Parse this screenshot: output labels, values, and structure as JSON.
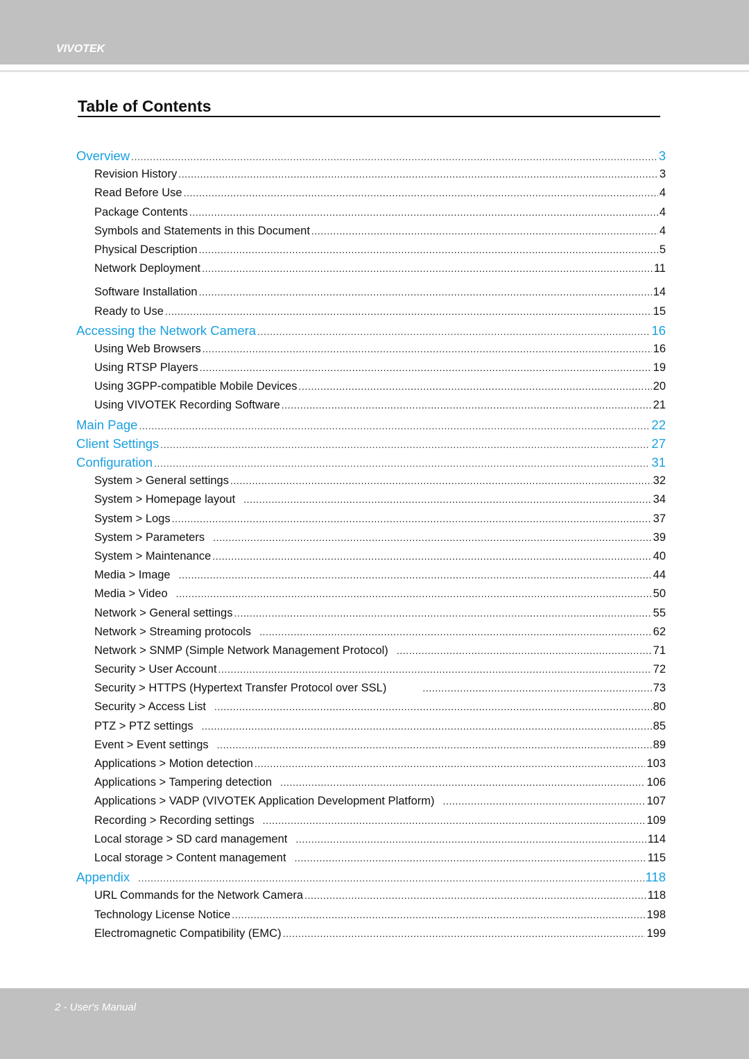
{
  "header": {
    "brand": "VIVOTEK"
  },
  "title": "Table of Contents",
  "colors": {
    "accent": "#1aa0e0",
    "band": "#bfc0bf",
    "text": "#111111"
  },
  "entries": [
    {
      "level": 1,
      "label": "Overview",
      "page": "3"
    },
    {
      "level": 2,
      "label": "Revision History",
      "page": "3"
    },
    {
      "level": 2,
      "label": "Read Before Use",
      "page": "4"
    },
    {
      "level": 2,
      "label": "Package Contents",
      "page": "4"
    },
    {
      "level": 2,
      "label": "Symbols and Statements in this Document",
      "page": "4"
    },
    {
      "level": 2,
      "label": "Physical Description",
      "page": "5"
    },
    {
      "level": 2,
      "label": "Network Deployment",
      "page": "11"
    },
    {
      "level": 2,
      "label": "Software Installation",
      "page": "14",
      "gap": true
    },
    {
      "level": 2,
      "label": "Ready to Use",
      "page": "15"
    },
    {
      "level": 1,
      "label": "Accessing the Network Camera",
      "page": "16"
    },
    {
      "level": 2,
      "label": "Using Web Browsers",
      "page": "16"
    },
    {
      "level": 2,
      "label": "Using RTSP Players",
      "page": "19"
    },
    {
      "level": 2,
      "label": "Using 3GPP-compatible Mobile Devices",
      "page": "20"
    },
    {
      "level": 2,
      "label": "Using VIVOTEK Recording Software",
      "page": "21"
    },
    {
      "level": 1,
      "label": "Main Page",
      "page": "22"
    },
    {
      "level": 1,
      "label": "Client Settings",
      "page": "27"
    },
    {
      "level": 1,
      "label": "Configuration",
      "page": "31"
    },
    {
      "level": 2,
      "label": "System > General settings",
      "page": "32"
    },
    {
      "level": 2,
      "label": "System > Homepage layout",
      "page": "34",
      "pad": true
    },
    {
      "level": 2,
      "label": "System > Logs",
      "page": "37"
    },
    {
      "level": 2,
      "label": "System > Parameters",
      "page": "39",
      "pad": true
    },
    {
      "level": 2,
      "label": "System > Maintenance",
      "page": "40"
    },
    {
      "level": 2,
      "label": "Media > Image",
      "page": "44",
      "pad": true
    },
    {
      "level": 2,
      "label": "Media > Video",
      "page": "50",
      "pad": true
    },
    {
      "level": 2,
      "label": "Network > General settings",
      "page": "55"
    },
    {
      "level": 2,
      "label": "Network > Streaming protocols",
      "page": "62",
      "pad": true
    },
    {
      "level": 2,
      "label": "Network > SNMP (Simple Network Management Protocol)",
      "page": "71",
      "pad": true
    },
    {
      "level": 2,
      "label": "Security > User Account",
      "page": "72"
    },
    {
      "level": 2,
      "label": "Security >  HTTPS (Hypertext Transfer Protocol over SSL)",
      "page": "73",
      "widepad": true
    },
    {
      "level": 2,
      "label": "Security >  Access List",
      "page": "80",
      "pad": true
    },
    {
      "level": 2,
      "label": "PTZ > PTZ settings",
      "page": "85",
      "pad": true
    },
    {
      "level": 2,
      "label": "Event > Event settings",
      "page": "89",
      "pad": true
    },
    {
      "level": 2,
      "label": "Applications > Motion detection",
      "page": "103"
    },
    {
      "level": 2,
      "label": "Applications > Tampering detection",
      "page": "106",
      "pad": true
    },
    {
      "level": 2,
      "label": "Applications > VADP (VIVOTEK Application Development Platform)",
      "page": "107",
      "pad": true
    },
    {
      "level": 2,
      "label": "Recording > Recording settings",
      "page": "109",
      "pad": true
    },
    {
      "level": 2,
      "label": "Local storage > SD card management",
      "page": "114",
      "pad": true
    },
    {
      "level": 2,
      "label": "Local storage > Content management",
      "page": "115",
      "pad": true
    },
    {
      "level": 1,
      "label": "Appendix",
      "page": "118",
      "pad": true
    },
    {
      "level": 2,
      "label": "URL Commands for the Network Camera",
      "page": "118"
    },
    {
      "level": 2,
      "label": "Technology License Notice",
      "page": "198"
    },
    {
      "level": 2,
      "label": "Electromagnetic Compatibility (EMC)",
      "page": "199"
    }
  ],
  "footer": {
    "page_label": "2 - User's Manual"
  }
}
